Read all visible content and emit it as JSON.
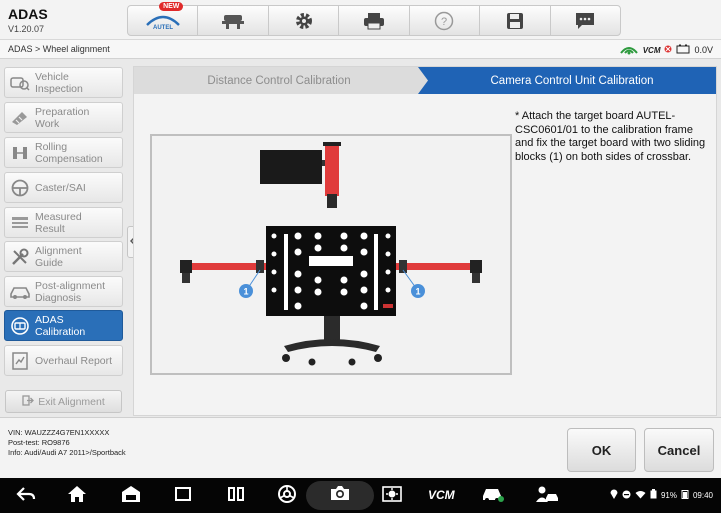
{
  "app": {
    "title": "ADAS",
    "version": "V1.20.07"
  },
  "toolbar": {
    "buttons": [
      {
        "icon": "autel-home-icon",
        "brand": "AUTEL",
        "badge": "NEW"
      },
      {
        "icon": "vehicle-lift-icon"
      },
      {
        "icon": "gear-icon"
      },
      {
        "icon": "printer-icon"
      },
      {
        "icon": "help-icon"
      },
      {
        "icon": "save-icon"
      },
      {
        "icon": "chat-icon"
      }
    ]
  },
  "breadcrumb": "ADAS > Wheel alignment",
  "status": {
    "vcm": "VCM",
    "voltage": "0.0V"
  },
  "sidebar": {
    "items": [
      {
        "label": "Vehicle\nInspection",
        "icon": "vehicle-inspection-icon",
        "active": false
      },
      {
        "label": "Preparation\nWork",
        "icon": "preparation-icon",
        "active": false
      },
      {
        "label": "Rolling\nCompensation",
        "icon": "rolling-icon",
        "active": false
      },
      {
        "label": "Caster/SAI",
        "icon": "steering-wheel-icon",
        "active": false
      },
      {
        "label": "Measured\nResult",
        "icon": "result-list-icon",
        "active": false
      },
      {
        "label": "Alignment\nGuide",
        "icon": "tools-icon",
        "active": false
      },
      {
        "label": "Post-alignment\nDiagnosis",
        "icon": "car-diagnosis-icon",
        "active": false
      },
      {
        "label": "ADAS\nCalibration",
        "icon": "adas-icon",
        "active": true
      },
      {
        "label": "Overhaul Report",
        "icon": "report-icon",
        "active": false
      }
    ],
    "exit_label": "Exit Alignment"
  },
  "tabs": [
    {
      "label": "Distance Control Calibration",
      "active": false
    },
    {
      "label": "Camera Control Unit Calibration",
      "active": true
    }
  ],
  "instruction": "* Attach the target board AUTEL-CSC0601/01 to the calibration frame and fix the target board with two sliding blocks (1) on both sides of crossbar.",
  "figure": {
    "callout_label": "1"
  },
  "vehicle_info": {
    "vin": "VIN: WAUZZZ4G7EN1XXXXX",
    "post_test": "Post-test: RO9876",
    "info": "Info: Audi/Audi A7 2011>/Sportback"
  },
  "actions": {
    "ok": "OK",
    "cancel": "Cancel"
  },
  "navbar": {
    "vcm": "VCM",
    "battery": "91%",
    "time": "09:40"
  },
  "colors": {
    "accent": "#1f63b5",
    "active_item": "#2a6fb8",
    "frame_red": "#e03b3b",
    "callout_blue": "#4a90d9"
  }
}
